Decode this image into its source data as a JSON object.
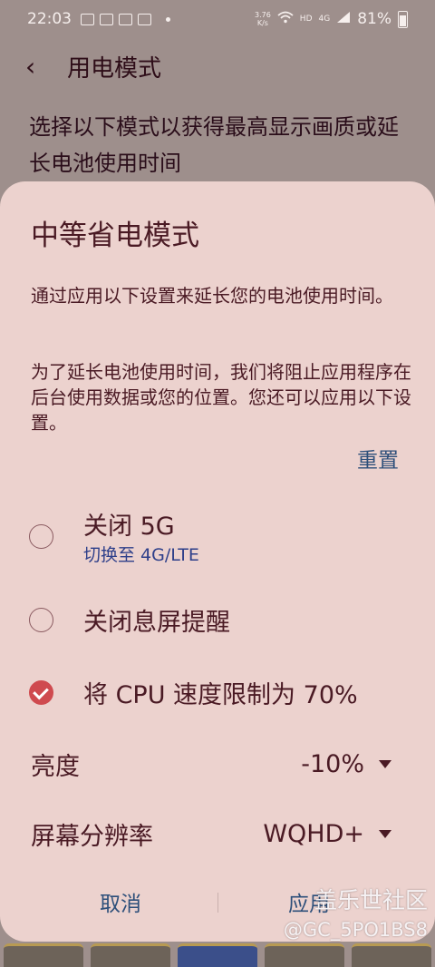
{
  "status_bar": {
    "time": "22:03",
    "net_speed_value": "3.76",
    "net_speed_unit": "K/s",
    "hd_label": "HD",
    "lte_label": "4G",
    "battery_percent": "81%"
  },
  "page": {
    "title": "用电模式",
    "description": "选择以下模式以获得最高显示画质或延长电池使用时间"
  },
  "dialog": {
    "title": "中等省电模式",
    "text1": "通过应用以下设置来延长您的电池使用时间。",
    "text2": "为了延长电池使用时间，我们将阻止应用程序在后台使用数据或您的位置。您还可以应用以下设置。",
    "reset_label": "重置",
    "options": [
      {
        "label": "关闭 5G",
        "sublabel": "切换至 4G/LTE",
        "checked": false
      },
      {
        "label": "关闭息屏提醒",
        "checked": false
      },
      {
        "label": "将 CPU 速度限制为 70%",
        "checked": true
      }
    ],
    "brightness": {
      "label": "亮度",
      "value": "-10%"
    },
    "resolution": {
      "label": "屏幕分辨率",
      "value": "WQHD+"
    },
    "cancel_label": "取消",
    "apply_label": "应用"
  },
  "watermark": {
    "line1": "盖乐世社区",
    "line2": "@GC_5PO1BS8"
  },
  "colors": {
    "dialog_bg": "#ecd2ce",
    "accent_check": "#cf4a4f",
    "link_blue": "#2d4f7a"
  }
}
